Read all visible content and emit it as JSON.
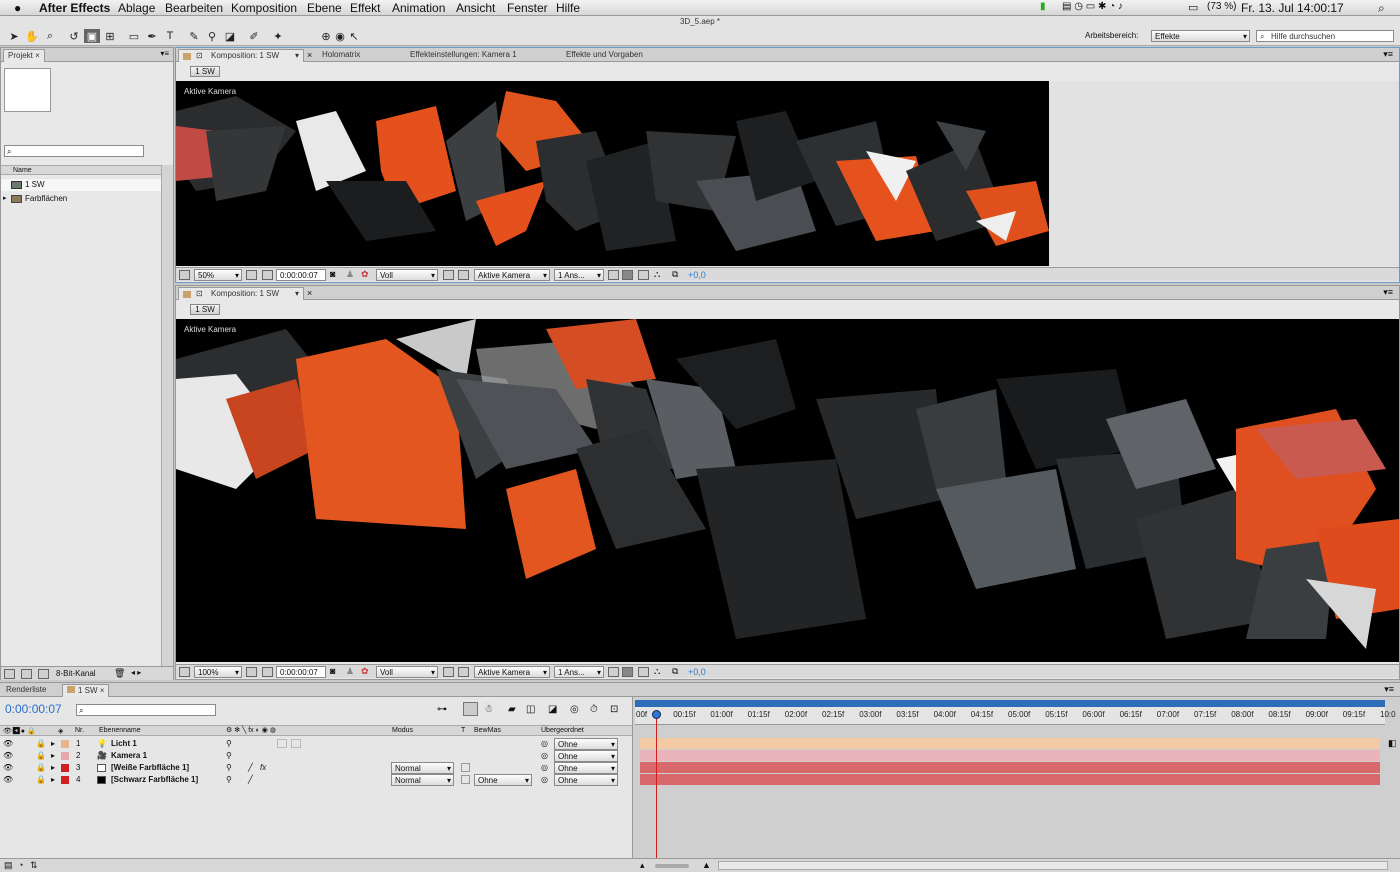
{
  "app": {
    "name": "After Effects",
    "menu": [
      "Ablage",
      "Bearbeiten",
      "Komposition",
      "Ebene",
      "Effekt",
      "Animation",
      "Ansicht",
      "Fenster",
      "Hilfe"
    ]
  },
  "status": {
    "battery": "(73 %)",
    "datetime": "Fr. 13. Jul  14:00:17"
  },
  "window_title": "3D_5.aep *",
  "workspace": {
    "label": "Arbeitsbereich:",
    "value": "Effekte",
    "help_placeholder": "Hilfe durchsuchen"
  },
  "project": {
    "tab": "Projekt",
    "col_name": "Name",
    "items": [
      "1 SW",
      "Farbflächen"
    ],
    "bit_depth": "8-Bit-Kanal"
  },
  "viewer_top": {
    "tabs": [
      "Komposition: 1 SW",
      "Holomatrix",
      "Effekteinstellungen: Kamera 1",
      "Effekte und Vorgaben"
    ],
    "breadcrumb": "1 SW",
    "camera_label": "Aktive Kamera",
    "zoom": "50%",
    "timecode": "0:00:00:07",
    "resolution": "Voll",
    "camera": "Aktive Kamera",
    "views": "1 Ans...",
    "exposure": "+0,0"
  },
  "viewer_bottom": {
    "tab": "Komposition: 1 SW",
    "breadcrumb": "1 SW",
    "camera_label": "Aktive Kamera",
    "zoom": "100%",
    "timecode": "0:00:00:07",
    "resolution": "Voll",
    "camera": "Aktive Kamera",
    "views": "1 Ans...",
    "exposure": "+0,0"
  },
  "timeline": {
    "tabs": [
      "Renderliste",
      "1 SW"
    ],
    "timecode": "0:00:00:07",
    "columns": {
      "nr": "Nr.",
      "name": "Ebenenname",
      "mode": "Modus",
      "t": "T",
      "trkmat": "BewMas",
      "parent": "Übergeordnet"
    },
    "layers": [
      {
        "nr": "1",
        "name": "Licht 1",
        "mode": "",
        "trkmat": "",
        "parent": "Ohne",
        "color": "#e8b68c"
      },
      {
        "nr": "2",
        "name": "Kamera 1",
        "mode": "",
        "trkmat": "",
        "parent": "Ohne",
        "color": "#e6a7ae"
      },
      {
        "nr": "3",
        "name": "[Weiße Farbfläche 1]",
        "mode": "Normal",
        "trkmat": "",
        "parent": "Ohne",
        "color": "#d05050"
      },
      {
        "nr": "4",
        "name": "[Schwarz Farbfläche 1]",
        "mode": "Normal",
        "trkmat": "Ohne",
        "parent": "Ohne",
        "color": "#d05050"
      }
    ],
    "ruler": [
      "00f",
      "00:15f",
      "01:00f",
      "01:15f",
      "02:00f",
      "02:15f",
      "03:00f",
      "03:15f",
      "04:00f",
      "04:15f",
      "05:00f",
      "05:15f",
      "06:00f",
      "06:15f",
      "07:00f",
      "07:15f",
      "08:00f",
      "08:15f",
      "09:00f",
      "09:15f",
      "10:0"
    ]
  },
  "colors": {
    "orange": "#e8561c",
    "bar_light": "#f3c9a6",
    "bar_pink": "#ebb4bb",
    "bar_red": "#d8686b"
  }
}
